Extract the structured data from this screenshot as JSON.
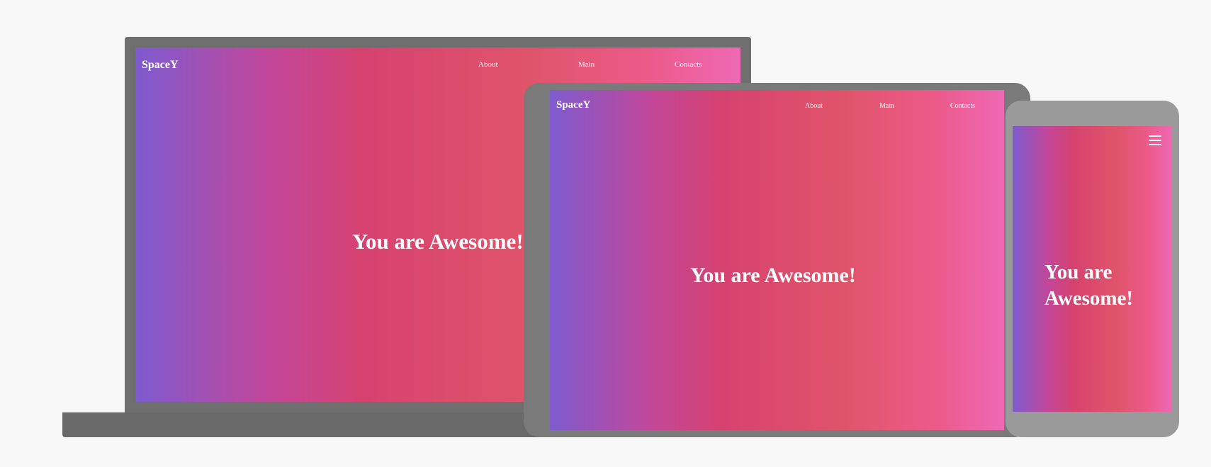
{
  "laptop": {
    "brand": "SpaceY",
    "nav": [
      "About",
      "Main",
      "Contacts"
    ],
    "hero": "You are Awesome!"
  },
  "tablet": {
    "brand": "SpaceY",
    "nav": [
      "About",
      "Main",
      "Contacts"
    ],
    "hero": "You are Awesome!"
  },
  "phone": {
    "menu_icon": "hamburger-icon",
    "hero_line1": "You are",
    "hero_line2": "Awesome!"
  },
  "colors": {
    "page_background": "#f8f8f8",
    "laptop_frame": "#6e6e6e",
    "tablet_frame": "#7a7a7a",
    "phone_frame": "#9a9a9a",
    "gradient": [
      "#7d5bcf",
      "#c2479a",
      "#d6426f",
      "#e0546a",
      "#ec5a8a",
      "#ee69b4"
    ],
    "text": "#ffffff"
  }
}
